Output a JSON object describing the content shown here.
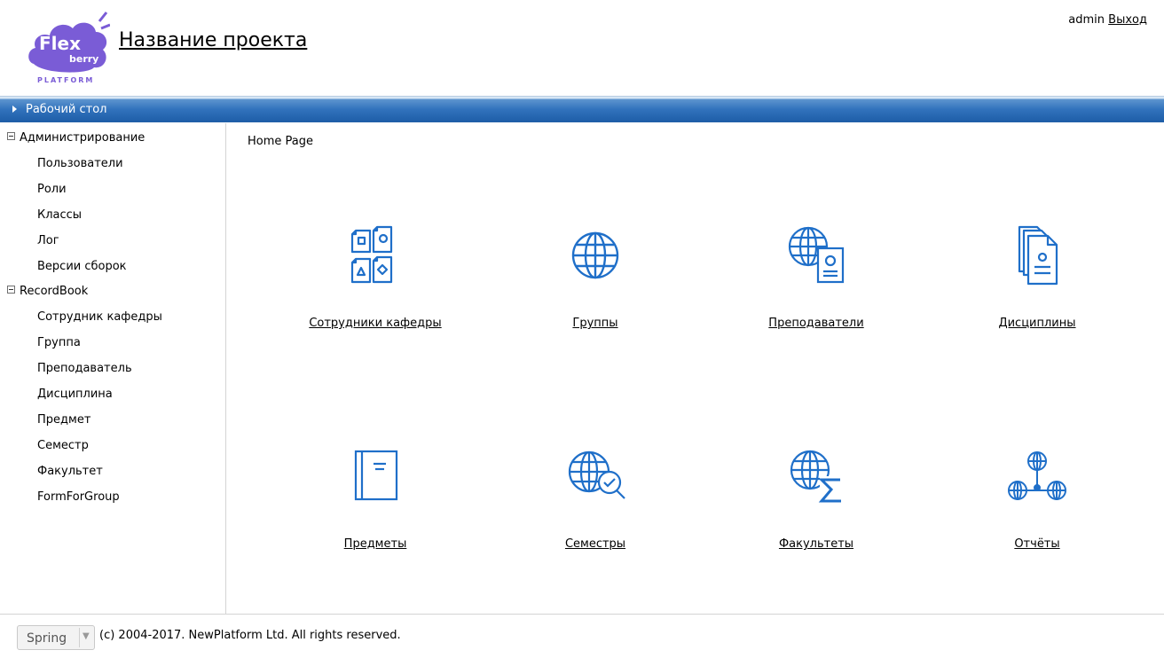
{
  "header": {
    "logo_text": "Flex",
    "logo_sub": "berry",
    "logo_platform": "PLATFORM",
    "project_title": "Название проекта",
    "user": "admin",
    "logout": "Выход"
  },
  "desktop_bar": {
    "label": "Рабочий стол"
  },
  "sidebar": {
    "groups": [
      {
        "label": "Администрирование",
        "items": [
          "Пользователи",
          "Роли",
          "Классы",
          "Лог",
          "Версии сборок"
        ]
      },
      {
        "label": "RecordBook",
        "items": [
          "Сотрудник кафедры",
          "Группа",
          "Преподаватель",
          "Дисциплина",
          "Предмет",
          "Семестр",
          "Факультет",
          "FormForGroup"
        ]
      }
    ]
  },
  "main": {
    "breadcrumb": "Home Page",
    "tiles": [
      {
        "label": "Сотрудники кафедры",
        "icon": "documents-shapes-icon"
      },
      {
        "label": "Группы",
        "icon": "globe-icon"
      },
      {
        "label": "Преподаватели",
        "icon": "globe-badge-icon"
      },
      {
        "label": "Дисциплины",
        "icon": "document-stack-icon"
      },
      {
        "label": "Предметы",
        "icon": "book-icon"
      },
      {
        "label": "Семестры",
        "icon": "globe-search-icon"
      },
      {
        "label": "Факультеты",
        "icon": "globe-sigma-icon"
      },
      {
        "label": "Отчёты",
        "icon": "globe-network-icon"
      }
    ]
  },
  "footer": {
    "theme_selected": "Spring",
    "copyright": "(c) 2004-2017. NewPlatform Ltd. All rights reserved."
  },
  "colors": {
    "accent": "#1f6fc9",
    "bar": "#2f6db5",
    "logo": "#7a5cd6"
  }
}
